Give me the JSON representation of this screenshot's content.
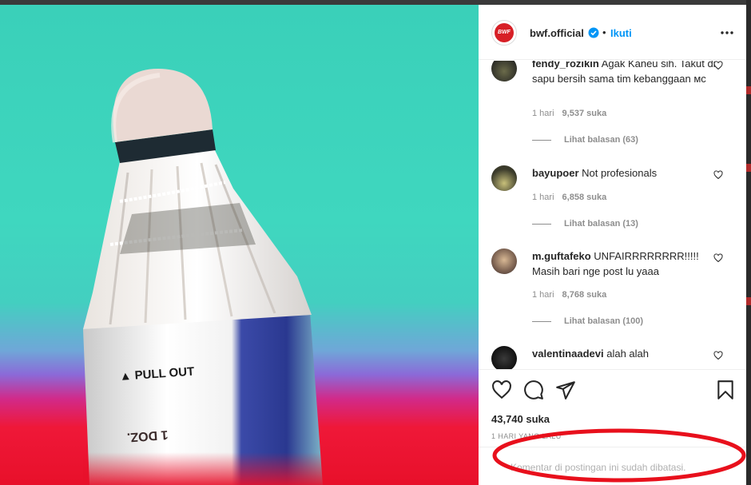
{
  "post": {
    "username": "bwf.official",
    "follow_label": "Ikuti",
    "separator": "•",
    "avatar_logo_text": "BWF",
    "photo_print_top": "▲ PULL OUT",
    "photo_print_bottom": "1 DOZ."
  },
  "comments": [
    {
      "username": "fendy_rozikin",
      "text": "Agak Kaneu sih. Takut di sapu bersih sama tim kebanggaan мс",
      "time": "1 hari",
      "likes": "9,537 suka",
      "replies": "Lihat balasan (63)"
    },
    {
      "username": "bayupoer",
      "text": "Not profesionals",
      "time": "1 hari",
      "likes": "6,858 suka",
      "replies": "Lihat balasan (13)"
    },
    {
      "username": "m.guftafeko",
      "text": "UNFAIRRRRRRRR!!!!! Masih bari nge post lu yaaa",
      "time": "1 hari",
      "likes": "8,768 suka",
      "replies": "Lihat balasan (100)"
    },
    {
      "username": "valentinaadevi",
      "text": "alah alah",
      "time": "",
      "likes": "",
      "replies": ""
    }
  ],
  "footer": {
    "likes_count": "43,740 suka",
    "timestamp": "1 HARI YANG LALU",
    "restricted_text": "Komentar di postingan ini sudah dibatasi."
  },
  "icons": {
    "like": "heart-icon",
    "comment": "comment-icon",
    "share": "paper-plane-icon",
    "save": "bookmark-icon",
    "more": "more-options-icon",
    "verified": "verified-badge-icon"
  },
  "colors": {
    "accent_link": "#0095f6",
    "verified": "#0095f6",
    "annotation_red": "#e8101c",
    "bwf_red": "#d71f26"
  }
}
